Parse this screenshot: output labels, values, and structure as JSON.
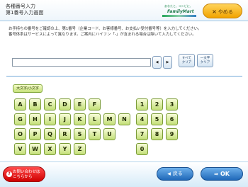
{
  "header": {
    "title_line1": "各種番号入力",
    "title_line2": "第1番号入力画面",
    "brand_top": "あなたと、コンビに、",
    "brand_name": "FamilyMart",
    "cancel_label": "やめる",
    "cancel_icon": "×"
  },
  "instructions": [
    "お手持ちの番号をご確認の上、第1番号（企業コード、お客様番号、お支払い受付番号等）を入力してください。",
    "番号体系はサービスによって異なります。ご案内にハイフン「-」が含まれる場合は除いて入力してください。"
  ],
  "input": {
    "value": "",
    "left_arrow": "◀",
    "right_arrow": "▶",
    "clear_all": [
      "すべて",
      "クリア"
    ],
    "clear_one": [
      "一文字",
      "クリア"
    ]
  },
  "keyboard": {
    "case_toggle": "大文字/小文字",
    "letters": [
      [
        "A",
        "B",
        "C",
        "D",
        "E",
        "F"
      ],
      [
        "G",
        "H",
        "I",
        "J",
        "K",
        "L",
        "M",
        "N"
      ],
      [
        "O",
        "P",
        "Q",
        "R",
        "S",
        "T",
        "U"
      ],
      [
        "V",
        "W",
        "X",
        "Y",
        "Z"
      ]
    ],
    "digits": [
      [
        "1",
        "2",
        "3"
      ],
      [
        "4",
        "5",
        "6"
      ],
      [
        "7",
        "8",
        "9"
      ],
      [
        "0"
      ]
    ]
  },
  "footer": {
    "help_line1": "お問い合わせは",
    "help_line2": "こちらから",
    "help_icon": "?",
    "back_label": "戻る",
    "back_icon": "◀",
    "ok_label": "OK",
    "ok_icon": "➡"
  }
}
